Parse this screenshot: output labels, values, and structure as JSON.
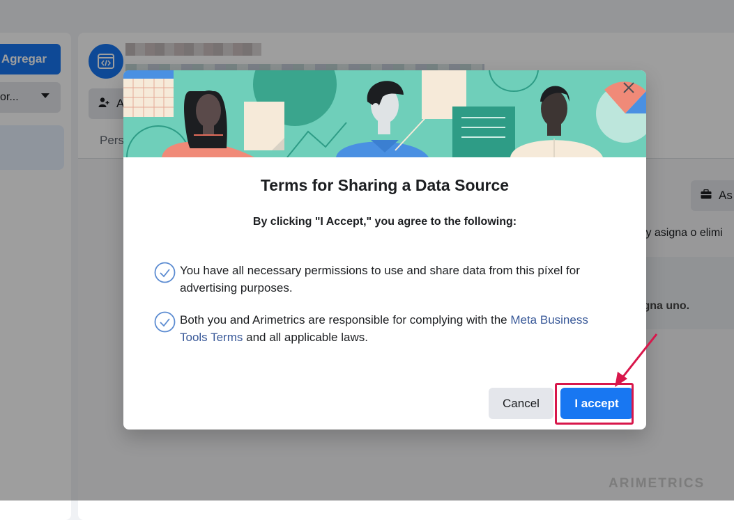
{
  "background": {
    "add_button": "Agregar",
    "filter_select": "or...",
    "assign_people_button": "A",
    "people_tab": "Pers",
    "assign_assets_button": "As",
    "description_fragment": "s y asigna o elimi",
    "empty_state_fragment": "igna uno.",
    "watermark": "ARIMETRICS"
  },
  "modal": {
    "title": "Terms for Sharing a Data Source",
    "subtitle": "By clicking \"I Accept,\" you agree to the following:",
    "terms": [
      {
        "text": "You have all necessary permissions to use and share data from this píxel for advertising purposes."
      },
      {
        "text_before": "Both you and Arimetrics are responsible for complying with the ",
        "link": "Meta Business Tools Terms",
        "text_after": " and all applicable laws."
      }
    ],
    "cancel_label": "Cancel",
    "accept_label": "I accept",
    "icons": {
      "close": "close-icon",
      "check": "check-circle-icon"
    }
  },
  "colors": {
    "primary": "#1877f2",
    "link": "#385898",
    "hero_bg": "#6fcfba",
    "highlight": "#d8174b"
  }
}
